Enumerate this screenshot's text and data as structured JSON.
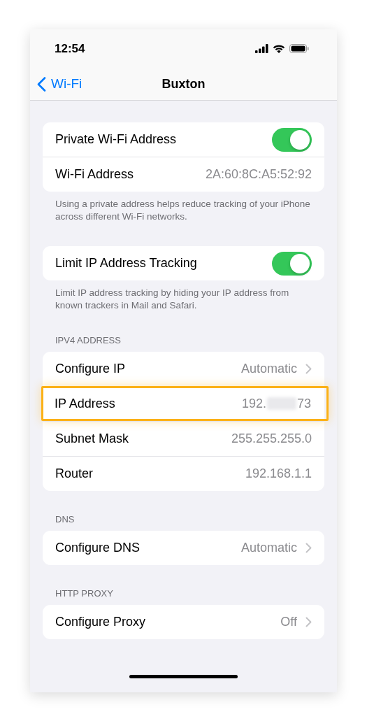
{
  "status_bar": {
    "time": "12:54"
  },
  "nav": {
    "back_label": "Wi-Fi",
    "title": "Buxton"
  },
  "sections": [
    {
      "rows": [
        {
          "kind": "toggle",
          "label": "Private Wi-Fi Address",
          "on": true
        },
        {
          "kind": "value",
          "label": "Wi-Fi Address",
          "value": "2A:60:8C:A5:52:92"
        }
      ],
      "footer": "Using a private address helps reduce tracking of your iPhone across different Wi-Fi networks."
    },
    {
      "rows": [
        {
          "kind": "toggle",
          "label": "Limit IP Address Tracking",
          "on": true
        }
      ],
      "footer": "Limit IP address tracking by hiding your IP address from known trackers in Mail and Safari."
    },
    {
      "header": "IPV4 ADDRESS",
      "rows": [
        {
          "kind": "link",
          "label": "Configure IP",
          "value": "Automatic"
        },
        {
          "kind": "value",
          "label": "IP Address",
          "value": "192.",
          "value_end": "73",
          "redacted": true,
          "highlighted": true
        },
        {
          "kind": "value",
          "label": "Subnet Mask",
          "value": "255.255.255.0"
        },
        {
          "kind": "value",
          "label": "Router",
          "value": "192.168.1.1"
        }
      ]
    },
    {
      "header": "DNS",
      "rows": [
        {
          "kind": "link",
          "label": "Configure DNS",
          "value": "Automatic"
        }
      ]
    },
    {
      "header": "HTTP PROXY",
      "rows": [
        {
          "kind": "link",
          "label": "Configure Proxy",
          "value": "Off"
        }
      ]
    }
  ]
}
